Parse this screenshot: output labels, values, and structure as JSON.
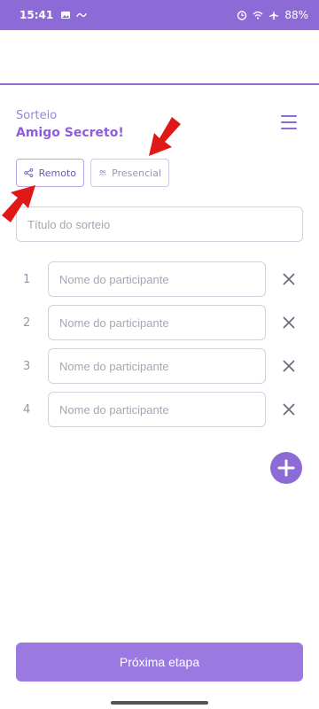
{
  "status_bar": {
    "time": "15:41",
    "battery": "88%"
  },
  "header": {
    "subtitle": "Sorteio",
    "title": "Amigo Secreto!"
  },
  "mode": {
    "remote_label": "Remoto",
    "presencial_label": "Presencial",
    "selected": "remote"
  },
  "draw": {
    "title_placeholder": "Título do sorteio"
  },
  "participants": [
    {
      "number": "1",
      "placeholder": "Nome do participante"
    },
    {
      "number": "2",
      "placeholder": "Nome do participante"
    },
    {
      "number": "3",
      "placeholder": "Nome do participante"
    },
    {
      "number": "4",
      "placeholder": "Nome do participante"
    }
  ],
  "actions": {
    "next_label": "Próxima etapa"
  },
  "colors": {
    "accent": "#8c6bd6",
    "annotation": "#e01818"
  },
  "icons": {
    "menu": "hamburger-icon",
    "remote": "share-icon",
    "presencial": "people-icon",
    "remove": "close-icon",
    "add": "plus-icon"
  }
}
